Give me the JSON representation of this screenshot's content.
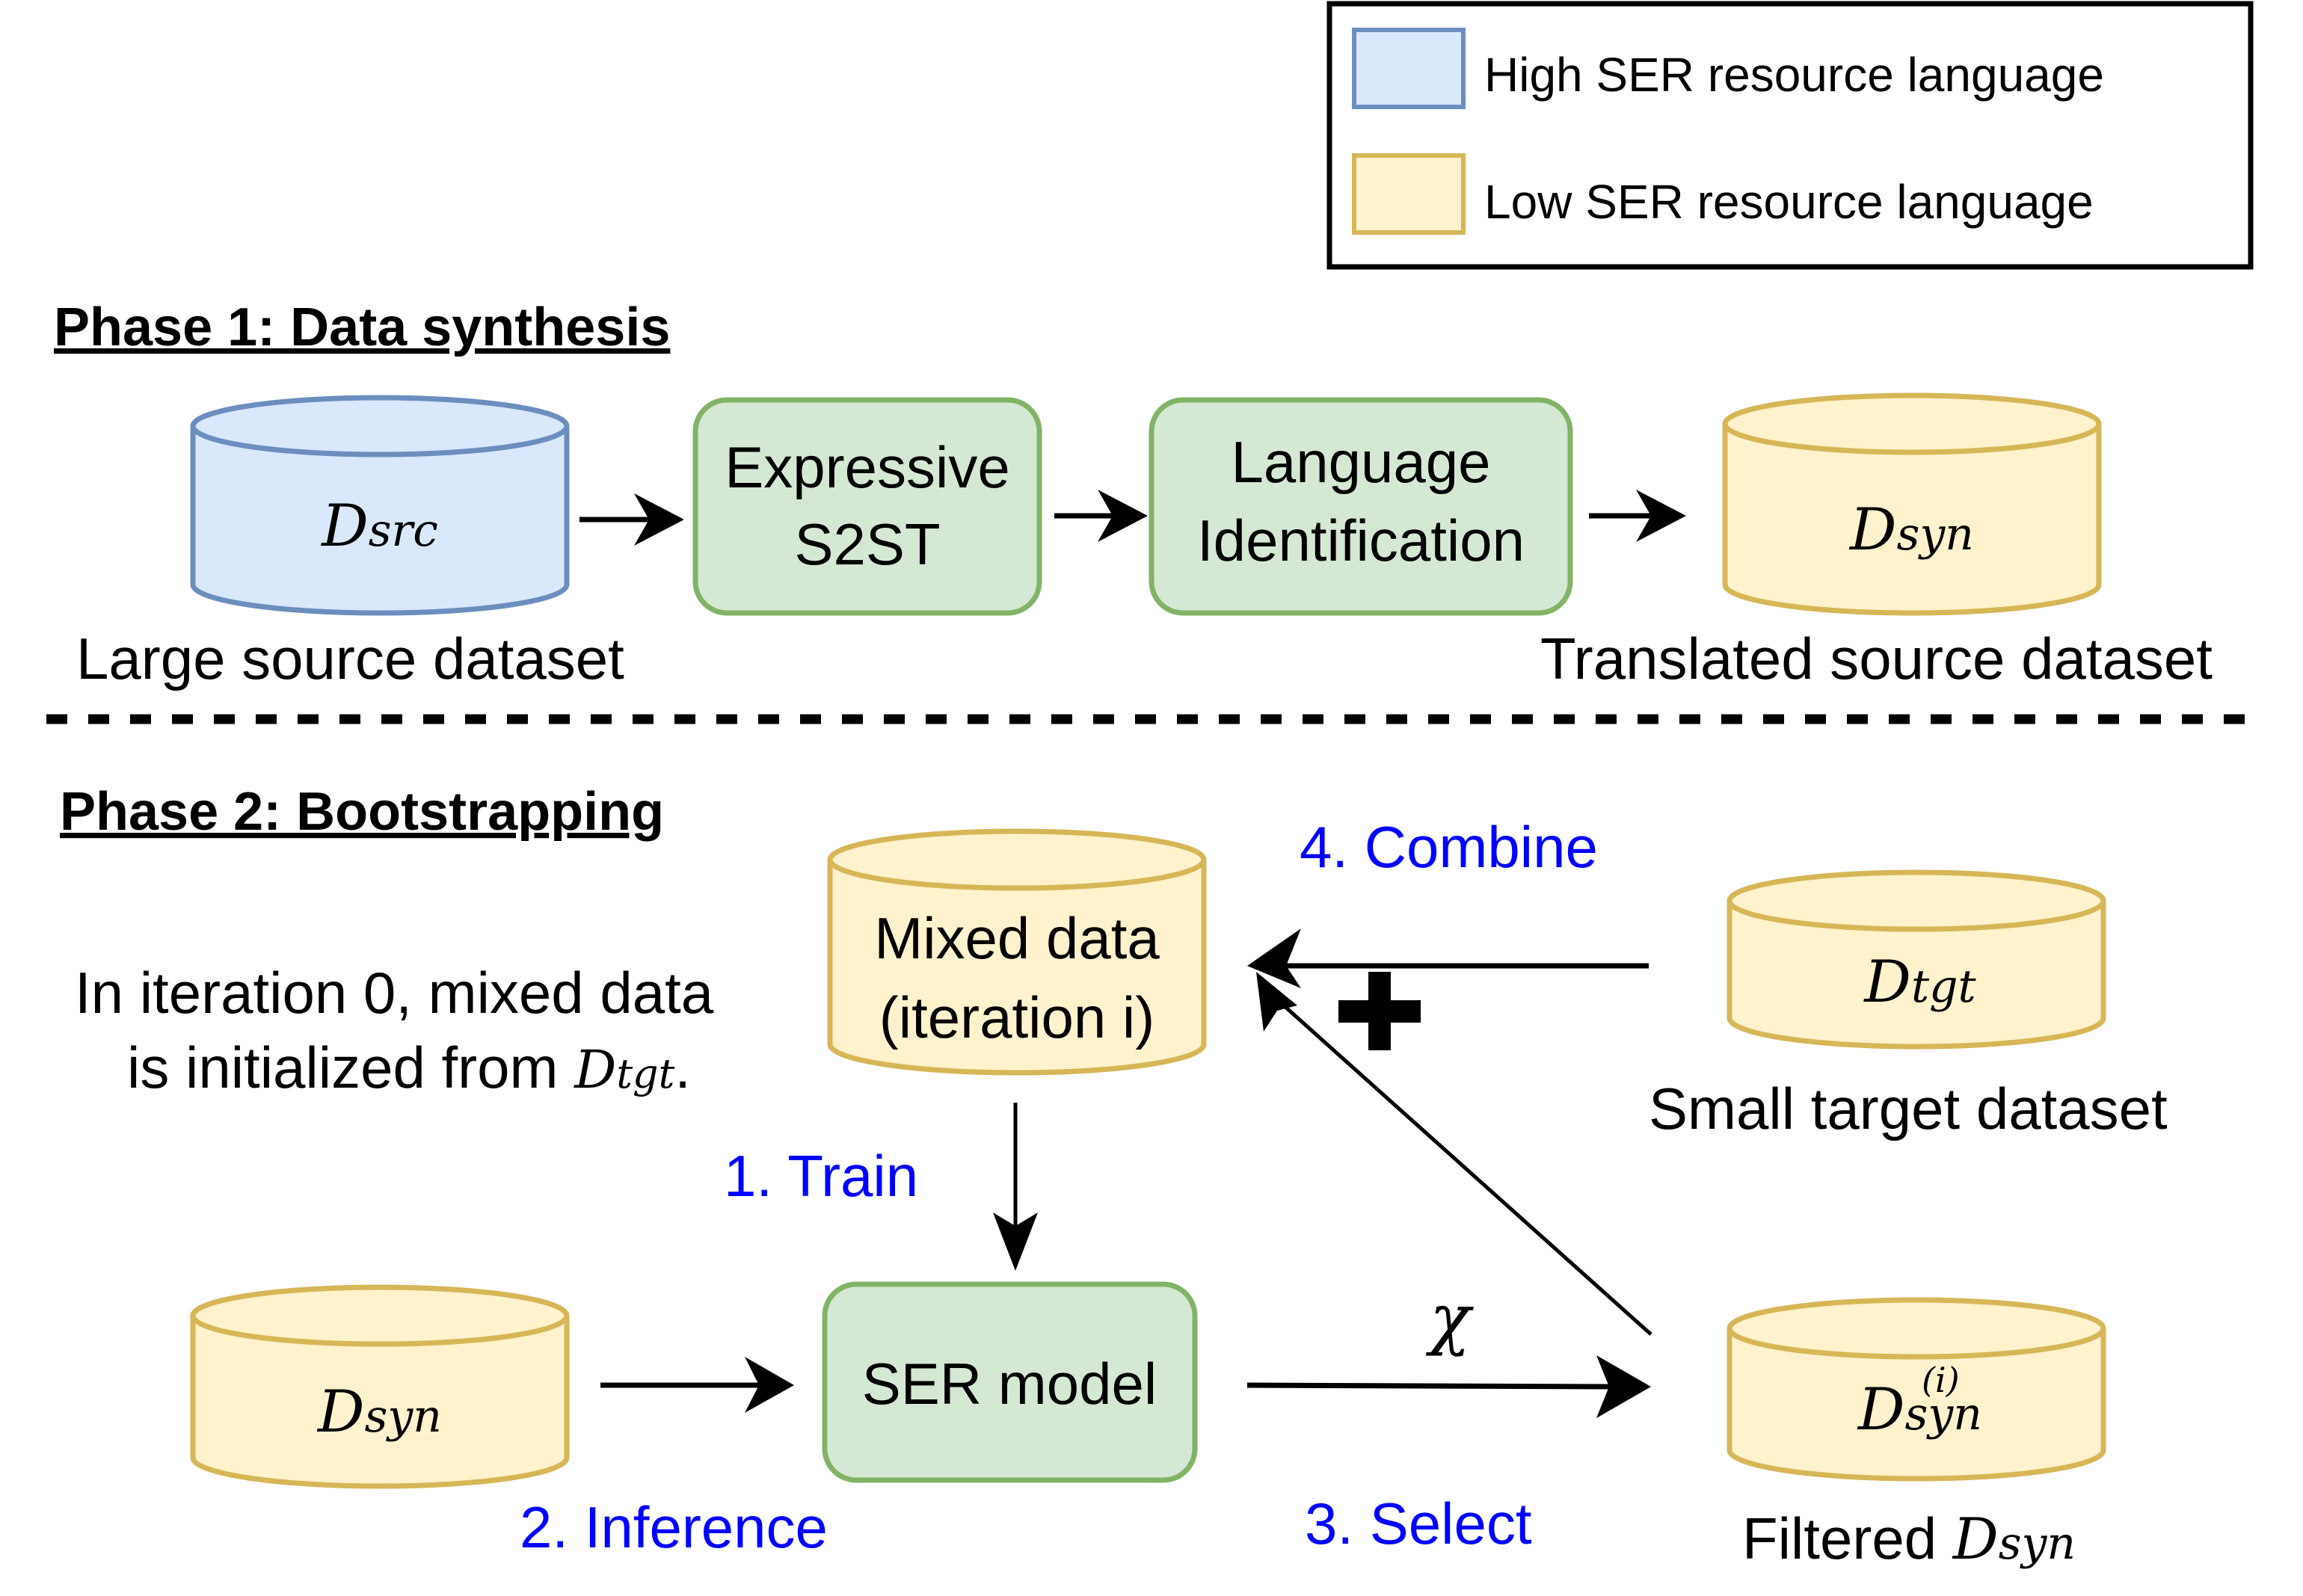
{
  "legend": {
    "items": [
      {
        "label": "High SER resource language",
        "fill": "#dae8fc",
        "stroke": "#6c8ebf"
      },
      {
        "label": "Low SER resource language",
        "fill": "#fff2cc",
        "stroke": "#d6b656"
      }
    ]
  },
  "colors": {
    "high_fill": "#dae8fc",
    "high_stroke": "#6c8ebf",
    "low_fill": "#fff2cc",
    "low_stroke": "#d6b656",
    "process_fill": "#d5e8d4",
    "process_stroke": "#82b366",
    "step_text": "#0000ff"
  },
  "phase1": {
    "title": "Phase 1: Data synthesis",
    "source_db": {
      "symbol": "D",
      "subscript": "src",
      "caption": "Large source dataset"
    },
    "process1": {
      "line1": "Expressive",
      "line2": "S2ST"
    },
    "process2": {
      "line1": "Language",
      "line2": "Identification"
    },
    "output_db": {
      "symbol": "D",
      "subscript": "syn",
      "caption": "Translated source dataset"
    }
  },
  "phase2": {
    "title": "Phase 2: Bootstrapping",
    "note_line1": "In iteration 0, mixed data",
    "note_line2_prefix": "is initialized from ",
    "note_symbol": "D",
    "note_subscript": "tgt",
    "note_suffix": ".",
    "mixed_db": {
      "line1": "Mixed data",
      "line2": "(iteration i)"
    },
    "target_db": {
      "symbol": "D",
      "subscript": "tgt",
      "caption": "Small target dataset"
    },
    "syn_db": {
      "symbol": "D",
      "subscript": "syn"
    },
    "model": {
      "label": "SER model"
    },
    "filtered_db": {
      "symbol": "D",
      "subscript": "syn",
      "superscript": "(i)",
      "caption_prefix": "Filtered ",
      "caption_symbol": "D",
      "caption_subscript": "syn"
    },
    "chi": "χ",
    "plus": "+",
    "steps": {
      "train": "1. Train",
      "inference": "2. Inference",
      "select": "3. Select",
      "combine": "4. Combine"
    }
  }
}
